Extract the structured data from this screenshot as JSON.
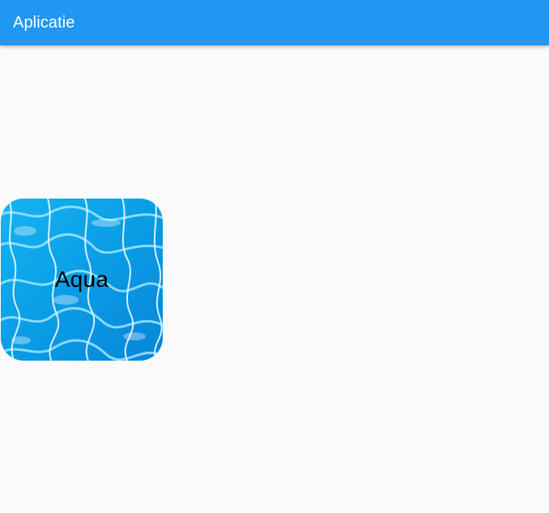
{
  "app_bar": {
    "title": "Aplicatie",
    "color": "#2196f3"
  },
  "tile": {
    "label": "Aqua",
    "background": "water-texture"
  }
}
